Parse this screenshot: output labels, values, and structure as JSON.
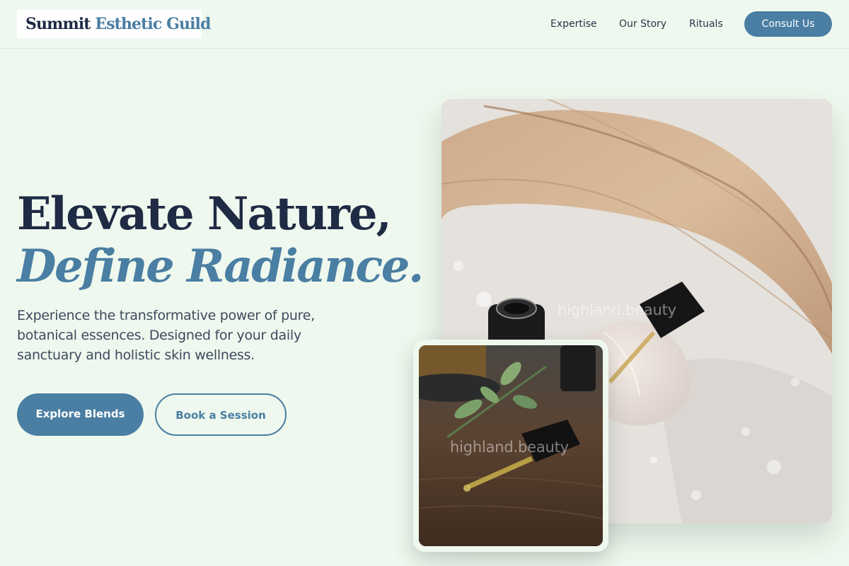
{
  "header": {
    "logo_part1": "Summit",
    "logo_part2": "Esthetic Guild",
    "nav": [
      "Expertise",
      "Our Story",
      "Rituals"
    ],
    "cta_label": "Consult Us"
  },
  "hero": {
    "title_line1": "Elevate Nature,",
    "title_line2": "Define Radiance.",
    "description": "Experience the transformative power of pure, botanical essences. Designed for your daily sanctuary and holistic skin wellness.",
    "primary_button": "Explore Blends",
    "secondary_button": "Book a Session"
  },
  "images": {
    "main_watermark": "highland.beauty",
    "small_watermark": "highland.beauty"
  },
  "colors": {
    "background": "#eff8ee",
    "accent": "#4a7ea3",
    "heading": "#1f2a44",
    "body_text": "#3d4a5e"
  }
}
